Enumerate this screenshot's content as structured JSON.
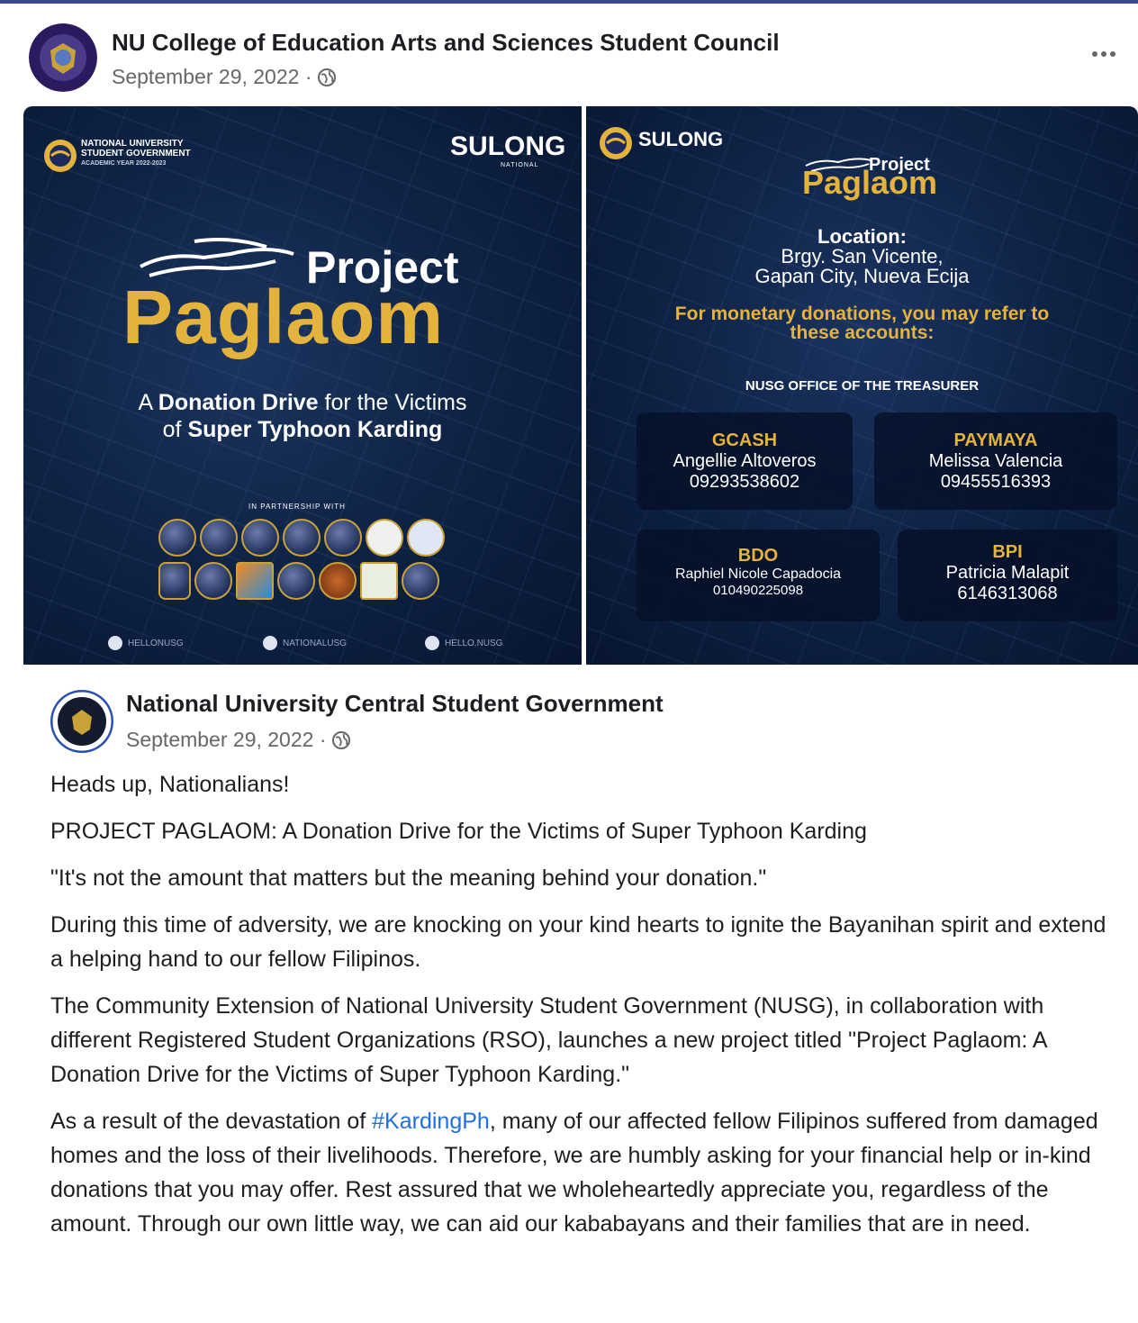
{
  "post": {
    "author": "NU College of Education Arts and Sciences Student Council",
    "date": "September 29, 2022 ·"
  },
  "shared": {
    "author": "National University Central Student Government",
    "date": "September 29, 2022 ·"
  },
  "left_panel": {
    "org_name_line1": "NATIONAL UNIVERSITY",
    "org_name_line2": "STUDENT GOVERNMENT",
    "org_name_line3": "ACADEMIC YEAR 2022-2023",
    "brand": "SULONG",
    "brand_sub": "NATIONAL",
    "title_small": "Project",
    "title_big": "Paglaom",
    "sub_pre": "A ",
    "sub_bold1": "Donation Drive",
    "sub_mid": " for the Victims",
    "sub_line2_pre": "of ",
    "sub_bold2": "Super Typhoon Karding",
    "partnership": "IN PARTNERSHIP WITH",
    "social1": "HELLONUSG",
    "social2": "NATIONALUSG",
    "social3": "HELLO.NUSG"
  },
  "right_panel": {
    "brand": "SULONG",
    "title_small": "Project",
    "title_big": "Paglaom",
    "location_label": "Location:",
    "location_line1": "Brgy. San Vicente,",
    "location_line2": "Gapan City, Nueva Ecija",
    "monetary_line1": "For monetary donations, you may refer to",
    "monetary_line2": "these accounts:",
    "office": "NUSG OFFICE OF THE TREASURER",
    "accounts": [
      {
        "bank": "GCASH",
        "name": "Angellie Altoveros",
        "number": "09293538602"
      },
      {
        "bank": "PAYMAYA",
        "name": "Melissa Valencia",
        "number": "09455516393"
      },
      {
        "bank": "BDO",
        "name": "Raphiel Nicole Capadocia",
        "number": "010490225098"
      },
      {
        "bank": "BPI",
        "name": "Patricia Malapit",
        "number": "6146313068"
      }
    ]
  },
  "body": {
    "p1": "Heads up, Nationalians!",
    "p2": "PROJECT PAGLAOM: A Donation Drive for the Victims of Super Typhoon Karding",
    "p3": "\"It's not the amount that matters but the meaning behind your donation.\"",
    "p4": "During this time of adversity, we are knocking on your kind hearts to ignite the Bayanihan spirit and extend a helping hand to our fellow Filipinos.",
    "p5": "The Community Extension of National University Student Government (NUSG), in collaboration with different Registered Student Organizations (RSO), launches a new project titled \"Project Paglaom: A Donation Drive for the Victims of Super Typhoon Karding.\"",
    "p6_pre": "As a result of the devastation of ",
    "p6_hashtag": "#KardingPh",
    "p6_post": ", many of our affected fellow Filipinos suffered from damaged homes and the loss of their livelihoods. Therefore, we are humbly asking for your financial help or in-kind donations that you may offer. Rest assured that we wholeheartedly appreciate you, regardless of the amount. Through our own little way, we can aid our kababayans and their families that are in need."
  },
  "colors": {
    "gold": "#e3b33d",
    "navy": "#0f2446",
    "hashtag": "#216fdb",
    "muted": "#65676b"
  }
}
